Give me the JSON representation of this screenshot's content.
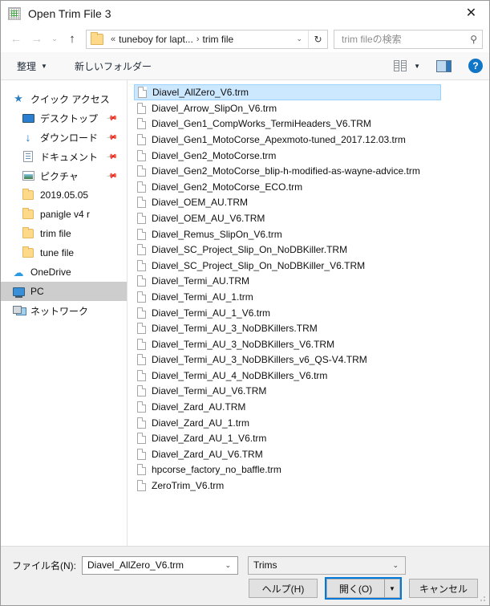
{
  "window": {
    "title": "Open Trim File 3",
    "app_icon": "grid-icon",
    "close_label": "✕"
  },
  "navigation": {
    "back_icon": "←",
    "forward_icon": "→",
    "history_icon": "⌄",
    "up_icon": "↑",
    "breadcrumb_separator_1": "«",
    "breadcrumb_1": "tuneboy for lapt...",
    "breadcrumb_separator_2": "›",
    "breadcrumb_2": "trim file",
    "dropdown_icon": "⌄",
    "refresh_icon": "↻"
  },
  "search": {
    "placeholder": "trim fileの検索",
    "icon": "⚲"
  },
  "toolbar": {
    "organize_label": "整理",
    "organize_caret": "▼",
    "new_folder_label": "新しいフォルダー",
    "view_caret": "▼",
    "help_label": "?"
  },
  "sidebar": {
    "items": [
      {
        "label": "クイック アクセス",
        "icon": "star-icon",
        "type": "header",
        "pinned": false,
        "selected": false
      },
      {
        "label": "デスクトップ",
        "icon": "monitor-icon",
        "type": "child",
        "pinned": true,
        "selected": false
      },
      {
        "label": "ダウンロード",
        "icon": "download-icon",
        "type": "child",
        "pinned": true,
        "selected": false
      },
      {
        "label": "ドキュメント",
        "icon": "document-icon",
        "type": "child",
        "pinned": true,
        "selected": false
      },
      {
        "label": "ピクチャ",
        "icon": "picture-icon",
        "type": "child",
        "pinned": true,
        "selected": false
      },
      {
        "label": "2019.05.05",
        "icon": "folder-icon",
        "type": "child",
        "pinned": false,
        "selected": false
      },
      {
        "label": "panigle v4 r",
        "icon": "folder-icon",
        "type": "child",
        "pinned": false,
        "selected": false
      },
      {
        "label": "trim file",
        "icon": "folder-icon",
        "type": "child",
        "pinned": false,
        "selected": false
      },
      {
        "label": "tune file",
        "icon": "folder-icon",
        "type": "child",
        "pinned": false,
        "selected": false
      },
      {
        "label": "OneDrive",
        "icon": "cloud-icon",
        "type": "root",
        "pinned": false,
        "selected": false
      },
      {
        "label": "PC",
        "icon": "pc-icon",
        "type": "root",
        "pinned": false,
        "selected": true
      },
      {
        "label": "ネットワーク",
        "icon": "network-icon",
        "type": "root",
        "pinned": false,
        "selected": false
      }
    ]
  },
  "filelist": {
    "files": [
      {
        "name": "Diavel_AllZero_V6.trm",
        "selected": true
      },
      {
        "name": "Diavel_Arrow_SlipOn_V6.trm",
        "selected": false
      },
      {
        "name": "Diavel_Gen1_CompWorks_TermiHeaders_V6.TRM",
        "selected": false
      },
      {
        "name": "Diavel_Gen1_MotoCorse_Apexmoto-tuned_2017.12.03.trm",
        "selected": false
      },
      {
        "name": "Diavel_Gen2_MotoCorse.trm",
        "selected": false
      },
      {
        "name": "Diavel_Gen2_MotoCorse_blip-h-modified-as-wayne-advice.trm",
        "selected": false
      },
      {
        "name": "Diavel_Gen2_MotoCorse_ECO.trm",
        "selected": false
      },
      {
        "name": "Diavel_OEM_AU.TRM",
        "selected": false
      },
      {
        "name": "Diavel_OEM_AU_V6.TRM",
        "selected": false
      },
      {
        "name": "Diavel_Remus_SlipOn_V6.trm",
        "selected": false
      },
      {
        "name": "Diavel_SC_Project_Slip_On_NoDBKiller.TRM",
        "selected": false
      },
      {
        "name": "Diavel_SC_Project_Slip_On_NoDBKiller_V6.TRM",
        "selected": false
      },
      {
        "name": "Diavel_Termi_AU.TRM",
        "selected": false
      },
      {
        "name": "Diavel_Termi_AU_1.trm",
        "selected": false
      },
      {
        "name": "Diavel_Termi_AU_1_V6.trm",
        "selected": false
      },
      {
        "name": "Diavel_Termi_AU_3_NoDBKillers.TRM",
        "selected": false
      },
      {
        "name": "Diavel_Termi_AU_3_NoDBKillers_V6.TRM",
        "selected": false
      },
      {
        "name": "Diavel_Termi_AU_3_NoDBKillers_v6_QS-V4.TRM",
        "selected": false
      },
      {
        "name": "Diavel_Termi_AU_4_NoDBKillers_V6.trm",
        "selected": false
      },
      {
        "name": "Diavel_Termi_AU_V6.TRM",
        "selected": false
      },
      {
        "name": "Diavel_Zard_AU.TRM",
        "selected": false
      },
      {
        "name": "Diavel_Zard_AU_1.trm",
        "selected": false
      },
      {
        "name": "Diavel_Zard_AU_1_V6.trm",
        "selected": false
      },
      {
        "name": "Diavel_Zard_AU_V6.TRM",
        "selected": false
      },
      {
        "name": "hpcorse_factory_no_baffle.trm",
        "selected": false
      },
      {
        "name": "ZeroTrim_V6.trm",
        "selected": false
      }
    ]
  },
  "footer": {
    "filename_label": "ファイル名(N):",
    "filename_value": "Diavel_AllZero_V6.trm",
    "filter_value": "Trims",
    "caret": "⌄",
    "help_button": "ヘルプ(H)",
    "open_button": "開く(O)",
    "open_split_caret": "▼",
    "cancel_button": "キャンセル"
  },
  "colors": {
    "selection_blue": "#cce8ff",
    "focus_blue": "#0078d7",
    "sidebar_selected": "#cdcdcd"
  }
}
